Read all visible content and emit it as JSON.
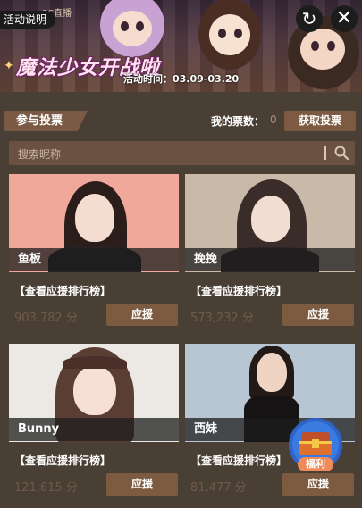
{
  "banner": {
    "logo_text": "CC直播",
    "title": "魔法少女开战啦",
    "date_text": "活动时间：03.09-03.20",
    "guide_label": "活动说明"
  },
  "controls": {
    "vote_tab_label": "参与投票",
    "my_votes_label": "我的票数：",
    "my_votes_count": "0",
    "get_votes_label": "获取投票"
  },
  "search": {
    "placeholder": "搜索昵称"
  },
  "cards": [
    {
      "name": "鱼板",
      "rank_label": "【查看应援排行榜】",
      "score": "903,782 分",
      "cheer_label": "应援"
    },
    {
      "name": "挽挽",
      "rank_label": "【查看应援排行榜】",
      "score": "573,232 分",
      "cheer_label": "应援"
    },
    {
      "name": "Bunny",
      "rank_label": "【查看应援排行榜】",
      "score": "121,615 分",
      "cheer_label": "应援"
    },
    {
      "name": "西妹",
      "rank_label": "【查看应援排行榜】",
      "score": "81,477 分",
      "cheer_label": "应援"
    }
  ],
  "welfare": {
    "label": "福利"
  },
  "icons": {
    "refresh": "refresh-icon",
    "close": "close-icon",
    "search": "search-icon",
    "chest": "treasure-chest-icon"
  },
  "colors": {
    "background": "#4a3f35",
    "button": "#7c5b40",
    "search_bg": "#6b513f",
    "score_text": "#6e5a49"
  }
}
